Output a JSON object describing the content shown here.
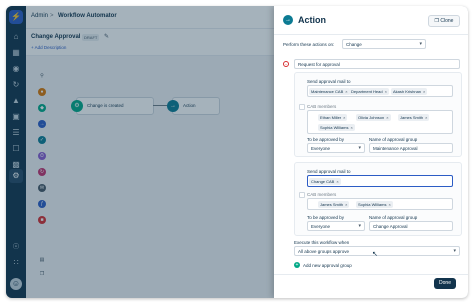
{
  "header": {
    "breadcrumb_root": "Admin",
    "breadcrumb_sep": ">",
    "breadcrumb_current": "Workflow Automator"
  },
  "workflow": {
    "name": "Change Approval",
    "status": "DRAFT",
    "add_description": "+ Add Description"
  },
  "canvas": {
    "nodes": [
      {
        "label": "Change is created",
        "icon": "event-icon"
      },
      {
        "label": "Action",
        "icon": "action-icon"
      }
    ]
  },
  "panel": {
    "title": "Action",
    "clone_label": "Clone",
    "perform_label": "Perform these actions on:",
    "perform_value": "Change",
    "action_value": "Request for approval",
    "groups": [
      {
        "send_to_label": "Send approval mail to",
        "recipients": [
          "Maintenance CAB",
          "Department Head",
          "Akash Krishnan"
        ],
        "cab_label": "CAB members",
        "cab_members": [
          "Ethan Miller",
          "Olivia Johnson",
          "James Smith",
          "Sophia Williams"
        ],
        "approved_by_label": "To be approved by",
        "approved_by_value": "Everyone",
        "group_name_label": "Name of approval group",
        "group_name_value": "Maintenance Approval"
      },
      {
        "send_to_label": "Send approval mail to",
        "recipients": [
          "Change CAB"
        ],
        "cab_label": "CAB members",
        "cab_members": [
          "James Smith",
          "Sophia Williams"
        ],
        "approved_by_label": "To be approved by",
        "approved_by_value": "Everyone",
        "group_name_label": "Name of approval group",
        "group_name_value": "Change Approval"
      }
    ],
    "execute_label": "Execute this workflow when",
    "execute_value": "All above groups approve",
    "add_group_label": "Add new approval group",
    "done_label": "Done"
  },
  "colors": {
    "sidebar": "#12344d",
    "accent": "#2c5cc5",
    "panel_icon": "#0c7b93",
    "delete": "#d72d30",
    "add": "#00a886"
  }
}
